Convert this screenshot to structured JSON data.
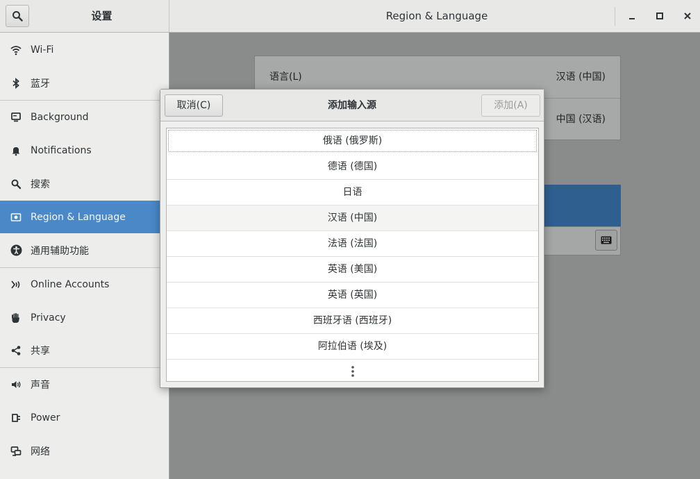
{
  "window": {
    "sidebar_title": "设置",
    "panel_title": "Region & Language",
    "controls": {
      "minimize": "minimize-icon",
      "maximize": "maximize-icon",
      "close": "close-icon"
    }
  },
  "sidebar": {
    "items": [
      {
        "label": "Wi-Fi",
        "icon": "wifi-icon"
      },
      {
        "label": "蓝牙",
        "icon": "bluetooth-icon"
      },
      {
        "label": "Background",
        "icon": "monitor-icon"
      },
      {
        "label": "Notifications",
        "icon": "bell-icon"
      },
      {
        "label": "搜索",
        "icon": "search-icon"
      },
      {
        "label": "Region & Language",
        "icon": "region-flag-icon",
        "active": true
      },
      {
        "label": "通用辅助功能",
        "icon": "accessibility-icon"
      },
      {
        "label": "Online Accounts",
        "icon": "online-accounts-icon"
      },
      {
        "label": "Privacy",
        "icon": "hand-icon"
      },
      {
        "label": "共享",
        "icon": "share-icon"
      },
      {
        "label": "声音",
        "icon": "speaker-icon"
      },
      {
        "label": "Power",
        "icon": "power-plug-icon"
      },
      {
        "label": "网络",
        "icon": "network-icon"
      }
    ]
  },
  "main": {
    "language_label": "语言(L)",
    "language_value": "汉语 (中国)",
    "formats_value": "中国 (汉语)"
  },
  "dialog": {
    "title": "添加输入源",
    "cancel_label": "取消(C)",
    "add_label": "添加(A)",
    "languages": [
      "俄语 (俄罗斯)",
      "德语 (德国)",
      "日语",
      "汉语 (中国)",
      "法语 (法国)",
      "英语 (美国)",
      "英语 (英国)",
      "西班牙语 (西班牙)",
      "阿拉伯语 (埃及)"
    ],
    "more_icon": "more-vertical-icon"
  },
  "colors": {
    "accent": "#4a88c7",
    "sidebar_bg": "#ededeb",
    "dim_overlay": "#8a8b8b"
  }
}
